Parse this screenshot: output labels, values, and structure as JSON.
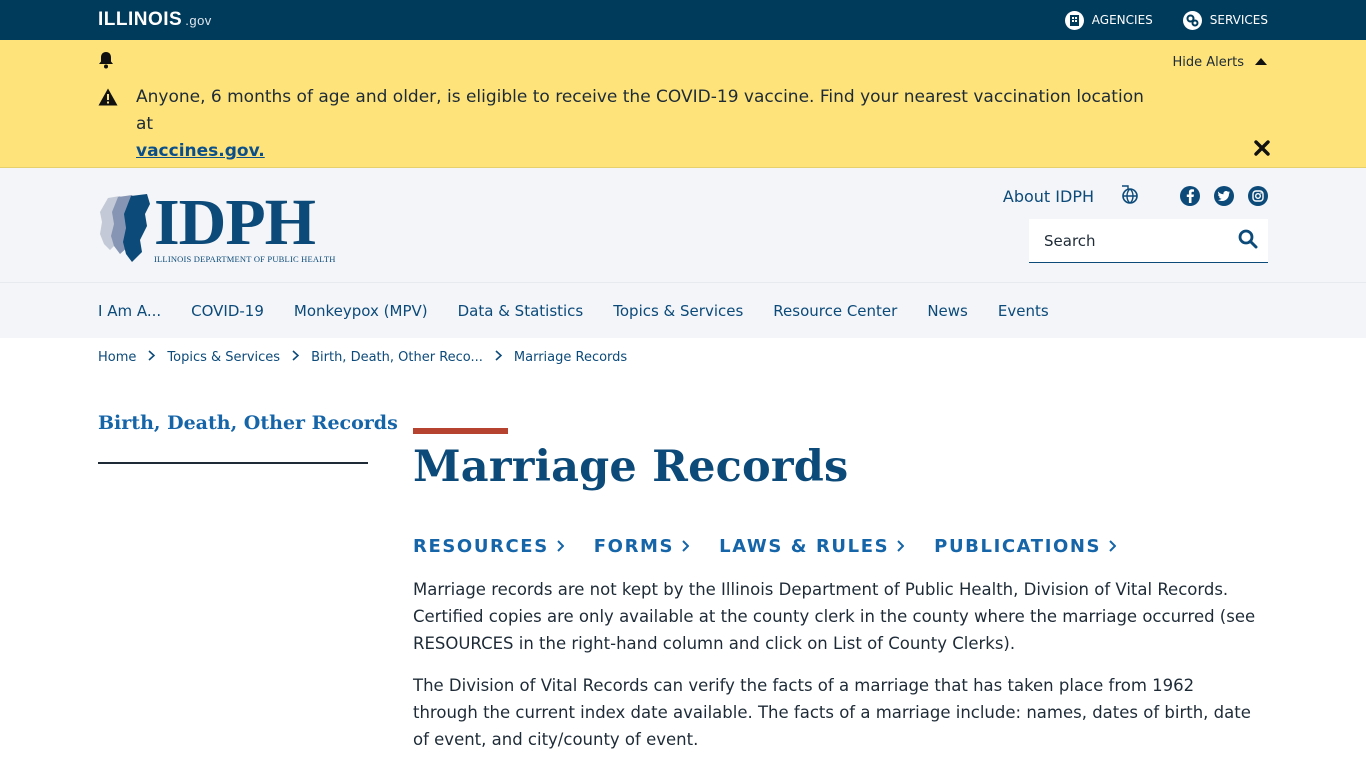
{
  "topbar": {
    "logo_text": "ILLINOIS",
    "logo_gov": ".gov",
    "agencies_label": "AGENCIES",
    "services_label": "SERVICES"
  },
  "alert": {
    "hide_label": "Hide Alerts",
    "message": "Anyone, 6 months of age and older, is eligible to receive the COVID-19 vaccine. Find your nearest vaccination location at ",
    "link_text": "vaccines.gov."
  },
  "header": {
    "logo_title": "IDPH",
    "logo_subtitle": "Illinois Department of Public Health",
    "about_label": "About IDPH",
    "search_placeholder": "Search"
  },
  "nav": {
    "items": [
      "I Am A...",
      "COVID-19",
      "Monkeypox (MPV)",
      "Data & Statistics",
      "Topics & Services",
      "Resource Center",
      "News",
      "Events"
    ]
  },
  "breadcrumb": {
    "items": [
      "Home",
      "Topics & Services",
      "Birth, Death, Other Reco...",
      "Marriage Records"
    ]
  },
  "sidebar": {
    "title": "Birth, Death, Other Records"
  },
  "main": {
    "title": "Marriage Records",
    "tabs": [
      "RESOURCES",
      "FORMS",
      "LAWS & RULES",
      "PUBLICATIONS"
    ],
    "paragraphs": [
      "Marriage records are not kept by the Illinois Department of Public Health, Division of Vital Records. Certified copies are only available at the county clerk in the county where the marriage occurred (see RESOURCES in the right-hand column and click on List of County Clerks).",
      "The Division of Vital Records can verify the facts of a marriage that has taken place from 1962 through the current index date available. The facts of a marriage include: names, dates of birth, date of event, and city/county of event."
    ]
  },
  "colors": {
    "topbar": "#003b5c",
    "alert_bg": "#fde37a",
    "brand_blue": "#0c4a7a",
    "link_blue": "#1565a8",
    "accent_red": "#b5432f"
  }
}
